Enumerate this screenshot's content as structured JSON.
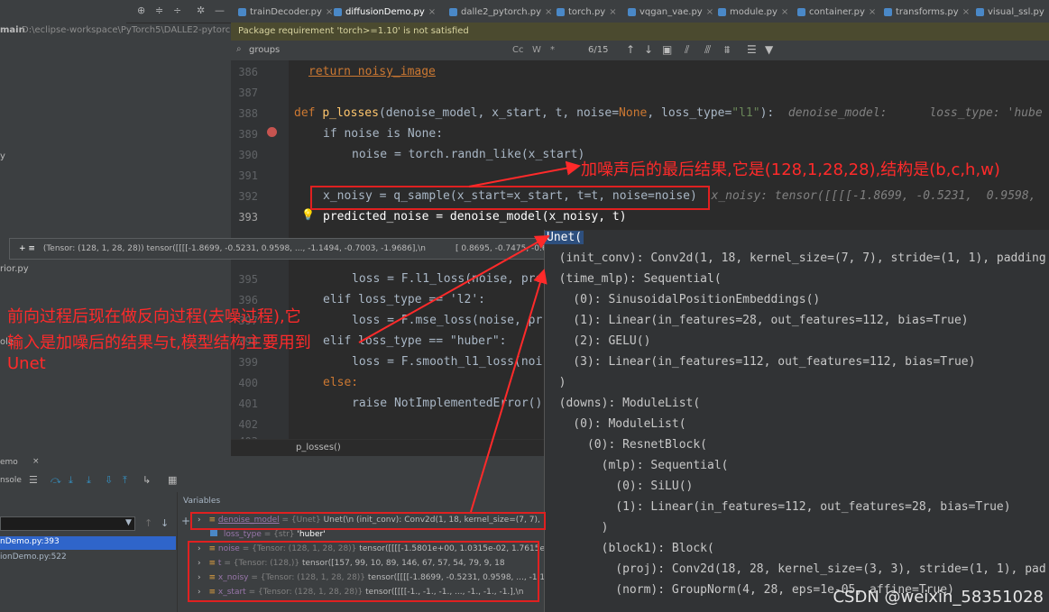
{
  "project": {
    "root_name": "main",
    "root_path": "D:\\eclipse-workspace\\PyTorch5\\DALLE2-pytorch-m",
    "frag_y": "y",
    "frag_py": "rior.py",
    "frag_ole": "ole"
  },
  "toolbar_icons": [
    "target-icon",
    "collapse-icon",
    "expand-icon",
    "gear-icon",
    "minimize-icon"
  ],
  "tabs": [
    {
      "label": "trainDecoder.py",
      "active": false
    },
    {
      "label": "diffusionDemo.py",
      "active": true
    },
    {
      "label": "dalle2_pytorch.py",
      "active": false
    },
    {
      "label": "torch.py",
      "active": false
    },
    {
      "label": "vqgan_vae.py",
      "active": false
    },
    {
      "label": "module.py",
      "active": false
    },
    {
      "label": "container.py",
      "active": false
    },
    {
      "label": "transforms.py",
      "active": false
    },
    {
      "label": "visual_ssl.py",
      "active": false
    }
  ],
  "banner": "Package requirement 'torch>=1.10' is not satisfied",
  "find": {
    "query": "groups",
    "cc": "Cc",
    "w": "W",
    "star": "*",
    "count": "6/15"
  },
  "code": {
    "lines": [
      "386",
      "387",
      "388",
      "389",
      "390",
      "391",
      "392",
      "393",
      "395",
      "396",
      "397",
      "398",
      "399",
      "400",
      "401",
      "402",
      "403"
    ],
    "l386": "return noisy_image",
    "l388_def": "def",
    "l388_fn": "p_losses",
    "l388_args": "(denoise_model, x_start, t, noise=",
    "l388_none": "None",
    "l388_rest": ", loss_type=",
    "l388_str": "\"l1\"",
    "l388_end": "):",
    "l388_hint": "denoise_model:      loss_type: 'hube",
    "l389": "if noise is None:",
    "l390": "noise = torch.randn_like(x_start)",
    "l392": "x_noisy = q_sample(x_start=x_start, t=t, noise=noise)",
    "l392_hint": "x_noisy: tensor([[[[-1.8699, -0.5231,  0.9598,",
    "l393": "predicted_noise = denoise_model(x_noisy, t)",
    "l395": "if loss_type == 'l1':",
    "l396": "loss = F.l1_loss(noise, pre",
    "l397": "elif loss_type == 'l2':",
    "l398": "loss = F.mse_loss(noise, pr",
    "l399": "elif loss_type == \"huber\":",
    "l400": "loss = F.smooth_l1_loss(noi",
    "l401": "else:",
    "l402": "raise NotImplementedError()"
  },
  "breadcrumb": "p_losses()",
  "tooltip": {
    "text": "(Tensor: (128, 1, 28, 28)) tensor([[[[-1.8699, -0.5231,  0.9598,  ...,  -1.1494, -0.7003, -1.9686],\\n",
    "tail": "[ 0.8695, -0.7475, -0.6"
  },
  "popup": [
    "Unet(",
    "  (init_conv): Conv2d(1, 18, kernel_size=(7, 7), stride=(1, 1), padding",
    "  (time_mlp): Sequential(",
    "    (0): SinusoidalPositionEmbeddings()",
    "    (1): Linear(in_features=28, out_features=112, bias=True)",
    "    (2): GELU()",
    "    (3): Linear(in_features=112, out_features=112, bias=True)",
    "  )",
    "  (downs): ModuleList(",
    "    (0): ModuleList(",
    "      (0): ResnetBlock(",
    "        (mlp): Sequential(",
    "          (0): SiLU()",
    "          (1): Linear(in_features=112, out_features=28, bias=True)",
    "        )",
    "        (block1): Block(",
    "          (proj): Conv2d(18, 28, kernel_size=(3, 3), stride=(1, 1), pad",
    "          (norm): GroupNorm(4, 28, eps=1e-05, affine=True)"
  ],
  "debug": {
    "tab_label": "emo",
    "console_label": "nsole",
    "variables_title": "Variables",
    "frames": [
      "nDemo.py:393",
      "ionDemo.py:522"
    ],
    "vars": [
      {
        "name": "denoise_model",
        "type": "= {Unet}",
        "value": "Unet(\\n  (init_conv): Conv2d(1, 18, kernel_size=(7, 7),"
      },
      {
        "name": "loss_type",
        "type": "= {str}",
        "value": "'huber'"
      },
      {
        "name": "noise",
        "type": "= {Tensor: (128, 1, 28, 28)}",
        "value": "tensor([[[[-1.5801e+00,  1.0315e-02,  1.7615e"
      },
      {
        "name": "t",
        "type": "= {Tensor: (128,)}",
        "value": "tensor([157,  99,  10,  89, 146,  67,  57,  54,  79,   9, 18"
      },
      {
        "name": "x_noisy",
        "type": "= {Tensor: (128, 1, 28, 28)}",
        "value": "tensor([[[[-1.8699, -0.5231,  0.9598,  ..., -1.1"
      },
      {
        "name": "x_start",
        "type": "= {Tensor: (128, 1, 28, 28)}",
        "value": "tensor([[[[-1., -1., -1.,  ..., -1., -1., -1.],\\n"
      }
    ]
  },
  "annotations": {
    "top": "加噪声后的最后结果,它是(128,1,28,28),结构是(b,c,h,w)",
    "left_1": "前向过程后现在做反向过程(去噪过程),它",
    "left_2": "输入是加噪后的结果与t,模型结构主要用到",
    "left_3": "Unet"
  },
  "watermark": "CSDN @weixin_58351028",
  "colors": {
    "annotation": "#ff2a2a",
    "selection": "#2d4f7e",
    "breakpoint": "#c75450"
  }
}
